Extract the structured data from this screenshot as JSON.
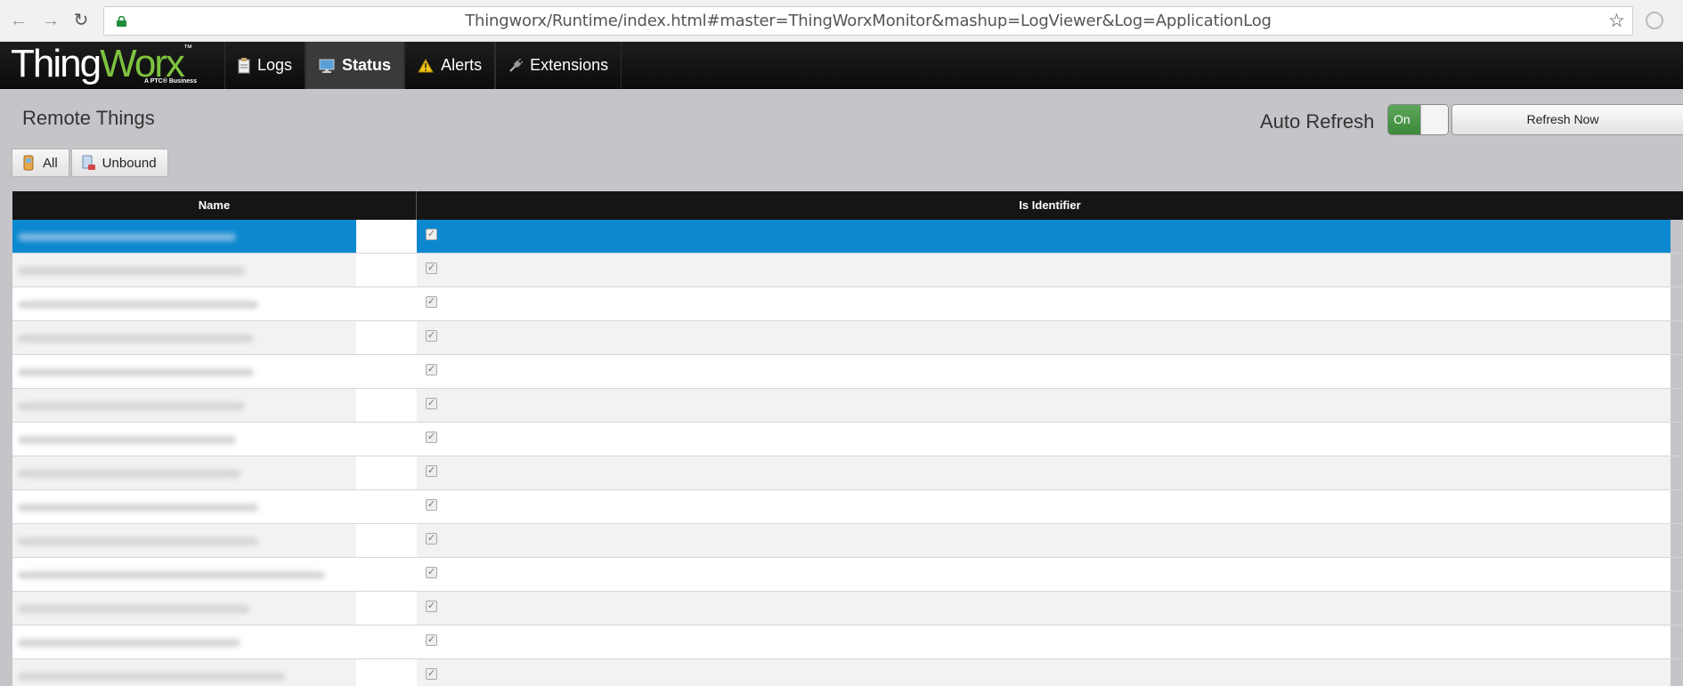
{
  "browser": {
    "url": "Thingworx/Runtime/index.html#master=ThingWorxMonitor&mashup=LogViewer&Log=ApplicationLog",
    "back_icon": "arrow-left-icon",
    "forward_icon": "arrow-right-icon",
    "reload_icon": "reload-icon",
    "star_icon": "star-icon"
  },
  "header": {
    "logo_main": "Thing",
    "logo_accent": "Worx",
    "logo_tm": "™",
    "logo_sub": "A PTC® Business",
    "tabs": [
      {
        "label": "Logs",
        "icon": "clipboard-icon",
        "active": false
      },
      {
        "label": "Status",
        "icon": "monitor-icon",
        "active": true
      },
      {
        "label": "Alerts",
        "icon": "warning-icon",
        "active": false
      },
      {
        "label": "Extensions",
        "icon": "plug-icon",
        "active": false
      }
    ]
  },
  "page": {
    "title": "Remote Things",
    "auto_refresh_label": "Auto Refresh",
    "toggle_label": "On",
    "refresh_button": "Refresh Now",
    "filters": [
      {
        "label": "All",
        "icon": "things-icon"
      },
      {
        "label": "Unbound",
        "icon": "unbound-icon"
      }
    ]
  },
  "grid": {
    "columns": [
      "Name",
      "Is Identifier"
    ],
    "rows": [
      {
        "is_identifier": true,
        "selected": true
      },
      {
        "is_identifier": true,
        "selected": false
      },
      {
        "is_identifier": true,
        "selected": false
      },
      {
        "is_identifier": true,
        "selected": false
      },
      {
        "is_identifier": true,
        "selected": false
      },
      {
        "is_identifier": true,
        "selected": false
      },
      {
        "is_identifier": true,
        "selected": false
      },
      {
        "is_identifier": true,
        "selected": false
      },
      {
        "is_identifier": true,
        "selected": false
      },
      {
        "is_identifier": true,
        "selected": false
      },
      {
        "is_identifier": true,
        "selected": false
      },
      {
        "is_identifier": true,
        "selected": false
      },
      {
        "is_identifier": true,
        "selected": false
      },
      {
        "is_identifier": true,
        "selected": false
      }
    ]
  },
  "colors": {
    "accent_green": "#7ec23f",
    "selection_blue": "#0b88cf",
    "toggle_green": "#4c974a"
  }
}
